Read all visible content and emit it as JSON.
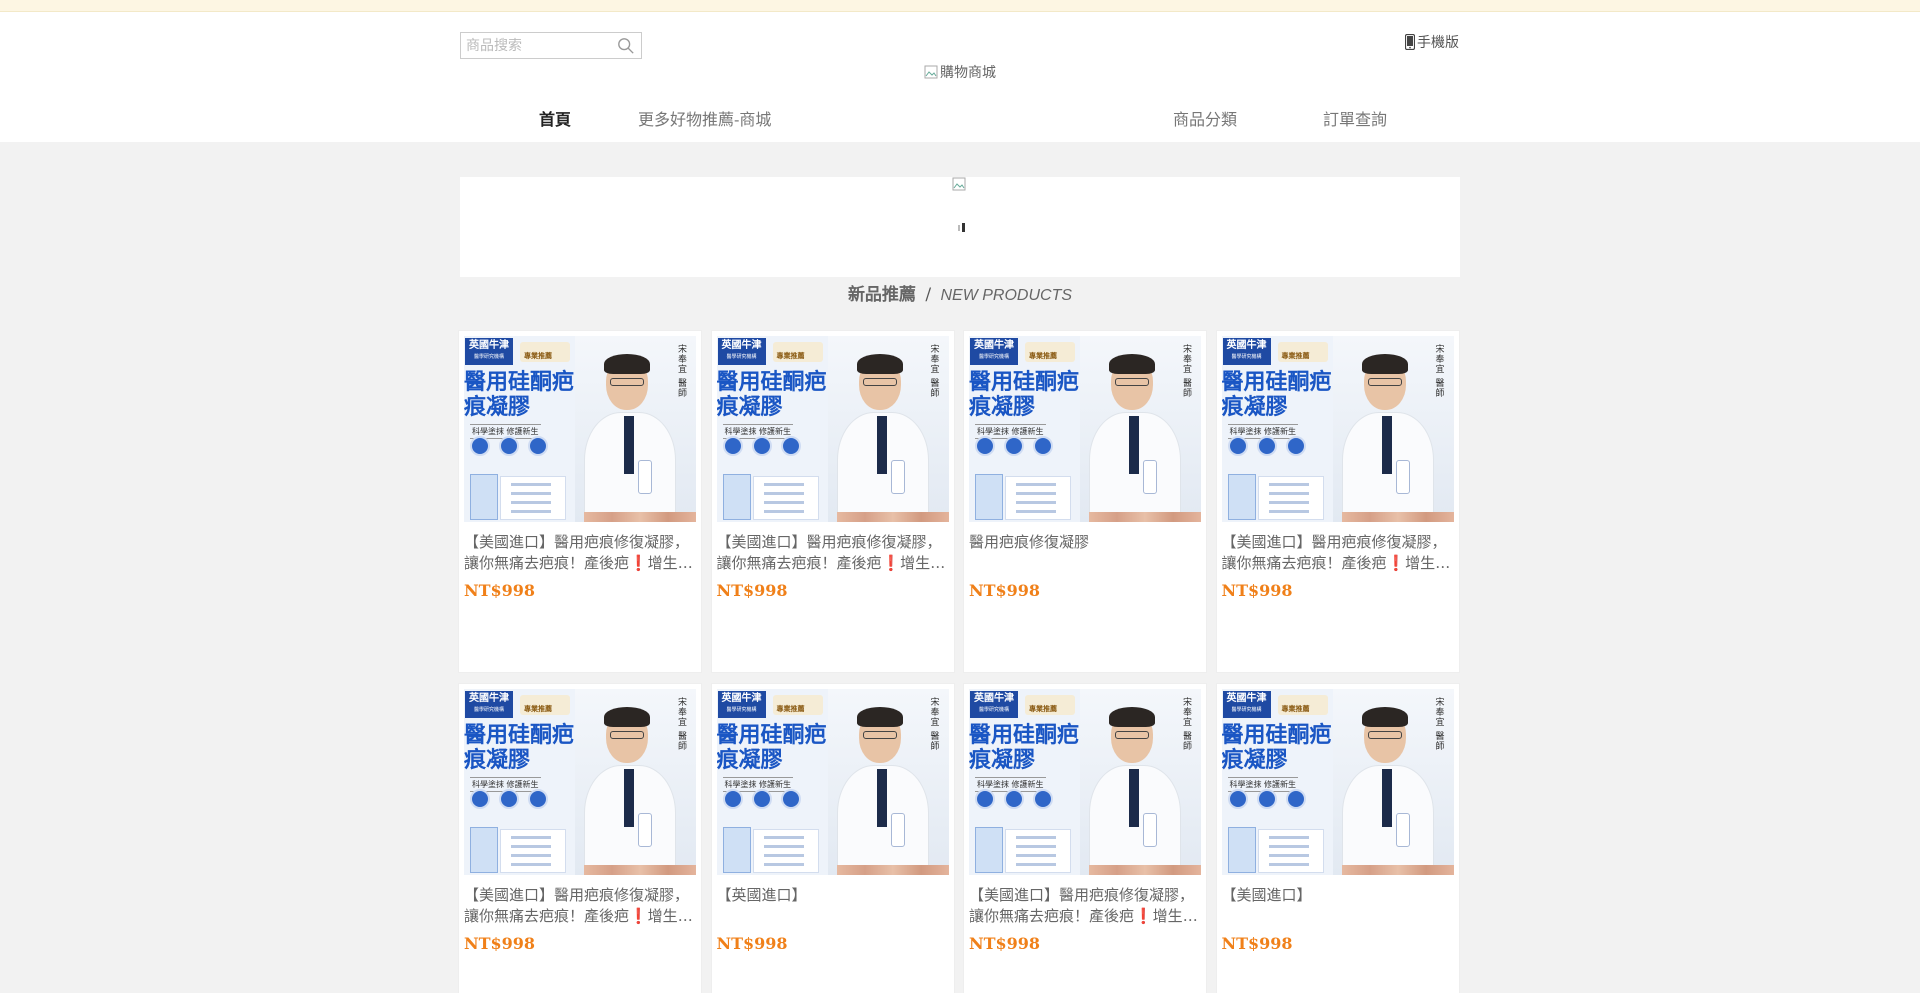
{
  "header": {
    "search_placeholder": "商品搜索",
    "mobile_label": "手機版",
    "logo_alt": "購物商城"
  },
  "nav": {
    "items": [
      {
        "label": "首頁",
        "active": true
      },
      {
        "label": "更多好物推薦-商城"
      },
      {
        "label": "商品分類"
      },
      {
        "label": "訂單查詢"
      }
    ]
  },
  "section": {
    "title_cn": "新品推薦",
    "separator": "/",
    "title_en": "NEW PRODUCTS"
  },
  "product_image_text": {
    "brand": "英國牛津",
    "brand_sub": "醫學研究機構",
    "badge": "專業推薦",
    "headline": "醫用硅酮疤痕凝膠",
    "subline": "科學塗抹 修護新生",
    "vertical": "宋奉宜 醫師"
  },
  "products": [
    {
      "name": "【美國進口】醫用疤痕修復凝膠，讓你無痛去疤痕！產後疤❗增生疤❗燒燙傷疤❗",
      "price": "NT$998"
    },
    {
      "name": "【美國進口】醫用疤痕修復凝膠，讓你無痛去疤痕！產後疤❗增生疤❗燒燙傷疤❗",
      "price": "NT$998"
    },
    {
      "name": "醫用疤痕修復凝膠",
      "price": "NT$998"
    },
    {
      "name": "【美國進口】醫用疤痕修復凝膠，讓你無痛去疤痕！產後疤❗增生疤❗燒燙傷疤❗",
      "price": "NT$998"
    },
    {
      "name": "【美國進口】醫用疤痕修復凝膠，讓你無痛去疤痕！產後疤❗增生疤❗燒燙傷疤❗",
      "price": "NT$998"
    },
    {
      "name": "【英國進口】",
      "price": "NT$998"
    },
    {
      "name": "【美國進口】醫用疤痕修復凝膠，讓你無痛去疤痕！產後疤❗增生疤❗燒燙傷疤❗",
      "price": "NT$998"
    },
    {
      "name": "【美國進口】",
      "price": "NT$998"
    }
  ]
}
